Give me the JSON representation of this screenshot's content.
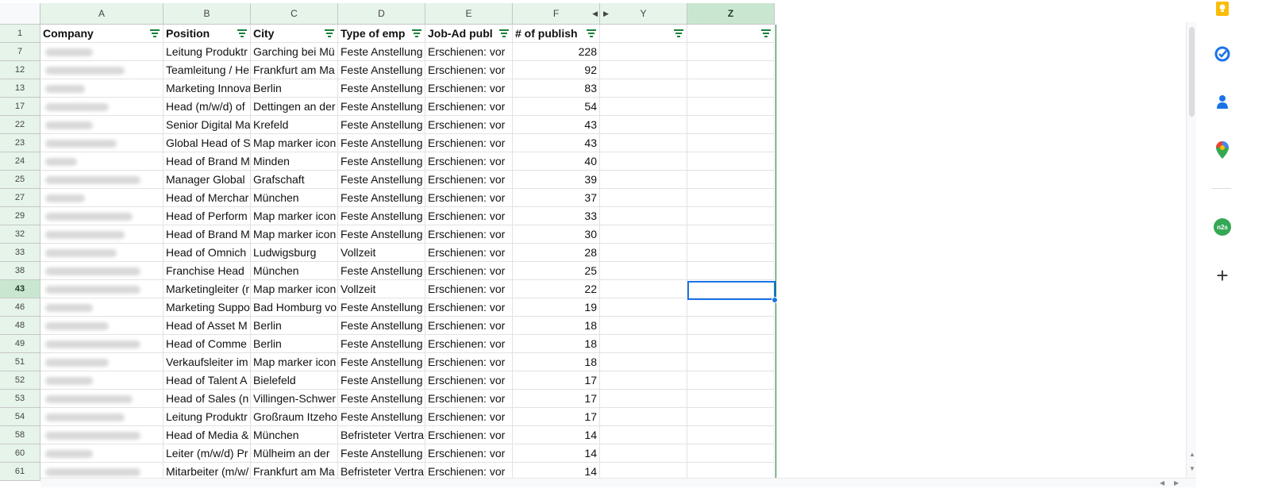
{
  "columns": [
    "A",
    "B",
    "C",
    "D",
    "E",
    "F",
    "Y",
    "Z"
  ],
  "header": [
    "Company",
    "Position",
    "City",
    "Type of emp",
    "Job-Ad publ",
    "# of publish",
    "",
    ""
  ],
  "rows": [
    {
      "num": "7",
      "position": "Leitung Produktr",
      "city": "Garching bei Mü",
      "type": "Feste Anstellung",
      "ad": "Erschienen: vor",
      "count": "228"
    },
    {
      "num": "12",
      "position": "Teamleitung / He",
      "city": "Frankfurt am Ma",
      "type": "Feste Anstellung",
      "ad": "Erschienen: vor",
      "count": "92"
    },
    {
      "num": "13",
      "position": "Marketing Innova",
      "city": "Berlin",
      "type": "Feste Anstellung",
      "ad": "Erschienen: vor",
      "count": "83"
    },
    {
      "num": "17",
      "position": "Head (m/w/d) of",
      "city": "Dettingen an der",
      "type": "Feste Anstellung",
      "ad": "Erschienen: vor",
      "count": "54"
    },
    {
      "num": "22",
      "position": "Senior Digital Ma",
      "city": "Krefeld",
      "type": "Feste Anstellung",
      "ad": "Erschienen: vor",
      "count": "43"
    },
    {
      "num": "23",
      "position": "Global Head of S",
      "city": "Map marker icon",
      "type": "Feste Anstellung",
      "ad": "Erschienen: vor",
      "count": "43"
    },
    {
      "num": "24",
      "position": "Head of Brand M",
      "city": "Minden",
      "type": "Feste Anstellung",
      "ad": "Erschienen: vor",
      "count": "40"
    },
    {
      "num": "25",
      "position": "Manager Global",
      "city": "Grafschaft",
      "type": "Feste Anstellung",
      "ad": "Erschienen: vor",
      "count": "39"
    },
    {
      "num": "27",
      "position": "Head of Merchar",
      "city": "München",
      "type": "Feste Anstellung",
      "ad": "Erschienen: vor",
      "count": "37"
    },
    {
      "num": "29",
      "position": "Head of Perform",
      "city": "Map marker icon",
      "type": "Feste Anstellung",
      "ad": "Erschienen: vor",
      "count": "33"
    },
    {
      "num": "32",
      "position": "Head of Brand M",
      "city": "Map marker icon",
      "type": "Feste Anstellung",
      "ad": "Erschienen: vor",
      "count": "30"
    },
    {
      "num": "33",
      "position": "Head of Omnich",
      "city": "Ludwigsburg",
      "type": "Vollzeit",
      "ad": "Erschienen: vor",
      "count": "28"
    },
    {
      "num": "38",
      "position": "Franchise Head",
      "city": "München",
      "type": "Feste Anstellung",
      "ad": "Erschienen: vor",
      "count": "25"
    },
    {
      "num": "43",
      "position": "Marketingleiter (r",
      "city": "Map marker icon",
      "type": "Vollzeit",
      "ad": "Erschienen: vor",
      "count": "22"
    },
    {
      "num": "46",
      "position": "Marketing Suppo",
      "city": "Bad Homburg vo",
      "type": "Feste Anstellung",
      "ad": "Erschienen: vor",
      "count": "19"
    },
    {
      "num": "48",
      "position": "Head of Asset M",
      "city": "Berlin",
      "type": "Feste Anstellung",
      "ad": "Erschienen: vor",
      "count": "18"
    },
    {
      "num": "49",
      "position": "Head of Comme",
      "city": "Berlin",
      "type": "Feste Anstellung",
      "ad": "Erschienen: vor",
      "count": "18"
    },
    {
      "num": "51",
      "position": "Verkaufsleiter im",
      "city": "Map marker icon",
      "type": "Feste Anstellung",
      "ad": "Erschienen: vor",
      "count": "18"
    },
    {
      "num": "52",
      "position": "Head of Talent A",
      "city": "Bielefeld",
      "type": "Feste Anstellung",
      "ad": "Erschienen: vor",
      "count": "17"
    },
    {
      "num": "53",
      "position": "Head of Sales (n",
      "city": "Villingen-Schwer",
      "type": "Feste Anstellung",
      "ad": "Erschienen: vor",
      "count": "17"
    },
    {
      "num": "54",
      "position": "Leitung Produktr",
      "city": "Großraum Itzeho",
      "type": "Feste Anstellung",
      "ad": "Erschienen: vor",
      "count": "17"
    },
    {
      "num": "58",
      "position": "Head of Media &",
      "city": "München",
      "type": "Befristeter Vertra",
      "ad": "Erschienen: vor",
      "count": "14"
    },
    {
      "num": "60",
      "position": "Leiter (m/w/d) Pr",
      "city": "Mülheim an der",
      "type": "Feste Anstellung",
      "ad": "Erschienen: vor",
      "count": "14"
    },
    {
      "num": "61",
      "position": "Mitarbeiter (m/w/",
      "city": "Frankfurt am Ma",
      "type": "Befristeter Vertra",
      "ad": "Erschienen: vor",
      "count": "14"
    }
  ],
  "header_row_num": "1",
  "selected_row": "43",
  "selected_column": "Z",
  "side_panel": {
    "icons": [
      "keep-icon",
      "tasks-icon",
      "contacts-icon",
      "maps-icon",
      "n2s-addon-icon",
      "add-icon"
    ],
    "n2s_label": "n2s",
    "add_label": "+"
  },
  "colors": {
    "header_green": "#e6f4ea",
    "filter_green": "#188038",
    "selection_blue": "#1a73e8"
  }
}
